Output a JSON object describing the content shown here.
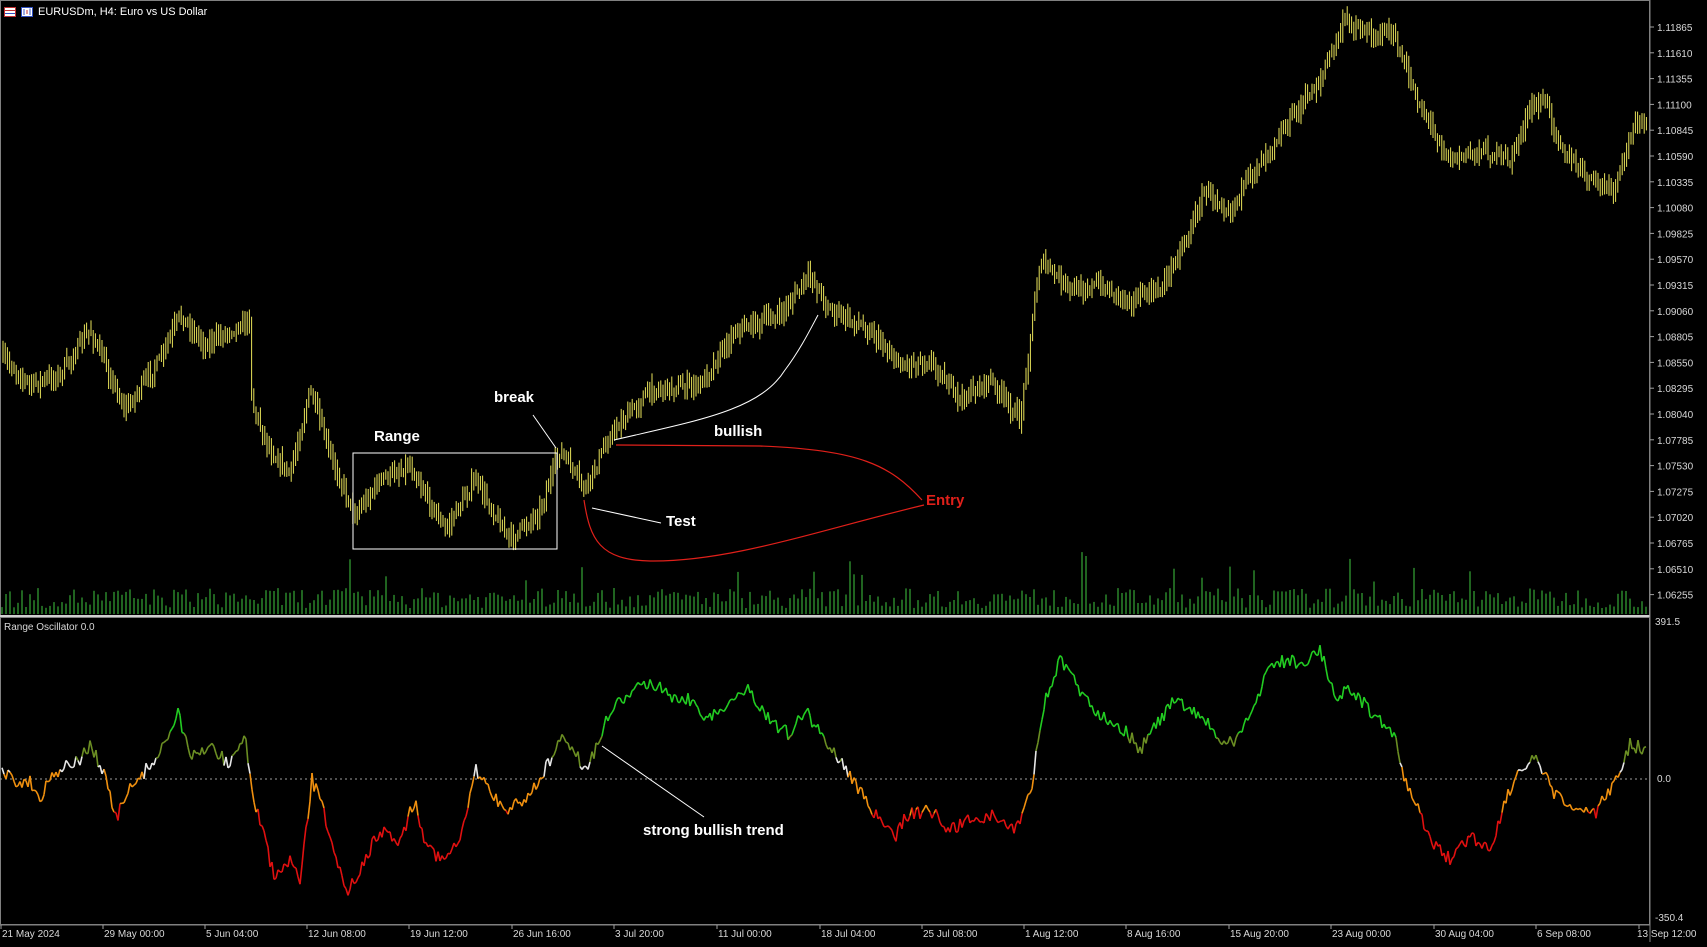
{
  "window": {
    "title": "EURUSDm, H4:  Euro vs US Dollar"
  },
  "icons": [
    "chart-grid-icon",
    "chart-bars-icon"
  ],
  "colors": {
    "background": "#000000",
    "candle": "#e8e25a",
    "volume": "#2f8f2f",
    "osc_green": "#22cc22",
    "osc_olive": "#6b8e23",
    "osc_white": "#e6e6e6",
    "osc_orange": "#f0900f",
    "osc_red": "#e01010",
    "entry": "#e0201a"
  },
  "price_axis": {
    "labels": [
      "1.11865",
      "1.11610",
      "1.11355",
      "1.11100",
      "1.10845",
      "1.10590",
      "1.10335",
      "1.10080",
      "1.09825",
      "1.09570",
      "1.09315",
      "1.09060",
      "1.08805",
      "1.08550",
      "1.08295",
      "1.08040",
      "1.07785",
      "1.07530",
      "1.07275",
      "1.07020",
      "1.06765",
      "1.06510",
      "1.06255"
    ]
  },
  "oscillator": {
    "title": "Range Oscillator 0.0",
    "max_label": "391.5",
    "zero_label": "0.0",
    "min_label": "-350.4"
  },
  "time_axis": {
    "labels": [
      "21 May 2024",
      "29 May 00:00",
      "5 Jun 04:00",
      "12 Jun 08:00",
      "19 Jun 12:00",
      "26 Jun 16:00",
      "3 Jul 20:00",
      "11 Jul 00:00",
      "18 Jul 04:00",
      "25 Jul 08:00",
      "1 Aug 12:00",
      "8 Aug 16:00",
      "15 Aug 20:00",
      "23 Aug 00:00",
      "30 Aug 04:00",
      "6 Sep 08:00",
      "13 Sep 12:00"
    ]
  },
  "annotations": {
    "range": "Range",
    "break": "break",
    "bullish": "bullish",
    "test": "Test",
    "entry": "Entry",
    "strong_bullish_trend": "strong bullish trend"
  },
  "chart_data": [
    {
      "type": "line",
      "title": "EURUSDm, H4:  Euro vs US Dollar",
      "ylim": [
        1.061,
        1.12
      ],
      "x": [
        "21 May",
        "29 May",
        "5 Jun",
        "8 Jun",
        "12 Jun",
        "19 Jun",
        "26 Jun",
        "29 Jun",
        "3 Jul",
        "11 Jul",
        "15 Jul",
        "18 Jul",
        "25 Jul",
        "1 Aug",
        "3 Aug",
        "8 Aug",
        "15 Aug",
        "20 Aug",
        "23 Aug",
        "30 Aug",
        "6 Sep",
        "13 Sep"
      ],
      "series": [
        {
          "values": [
            1.086,
            1.083,
            1.0885,
            1.08,
            1.073,
            1.0735,
            1.07,
            1.075,
            1.082,
            1.087,
            1.09,
            1.092,
            1.086,
            1.0795,
            1.096,
            1.092,
            1.102,
            1.113,
            1.118,
            1.106,
            1.109,
            1.108
          ]
        }
      ]
    },
    {
      "type": "line",
      "title": "Range Oscillator 0.0",
      "ylim": [
        -350.4,
        391.5
      ],
      "x": [
        "21 May",
        "29 May",
        "5 Jun",
        "8 Jun",
        "12 Jun",
        "19 Jun",
        "26 Jun",
        "29 Jun",
        "3 Jul",
        "11 Jul",
        "15 Jul",
        "18 Jul",
        "25 Jul",
        "1 Aug",
        "3 Aug",
        "8 Aug",
        "15 Aug",
        "20 Aug",
        "23 Aug",
        "30 Aug",
        "6 Sep",
        "13 Sep"
      ],
      "series": [
        {
          "values": [
            10,
            -60,
            120,
            -250,
            -300,
            -180,
            -60,
            20,
            250,
            260,
            210,
            60,
            -160,
            -160,
            340,
            160,
            230,
            360,
            320,
            -230,
            -40,
            80
          ]
        }
      ]
    }
  ]
}
